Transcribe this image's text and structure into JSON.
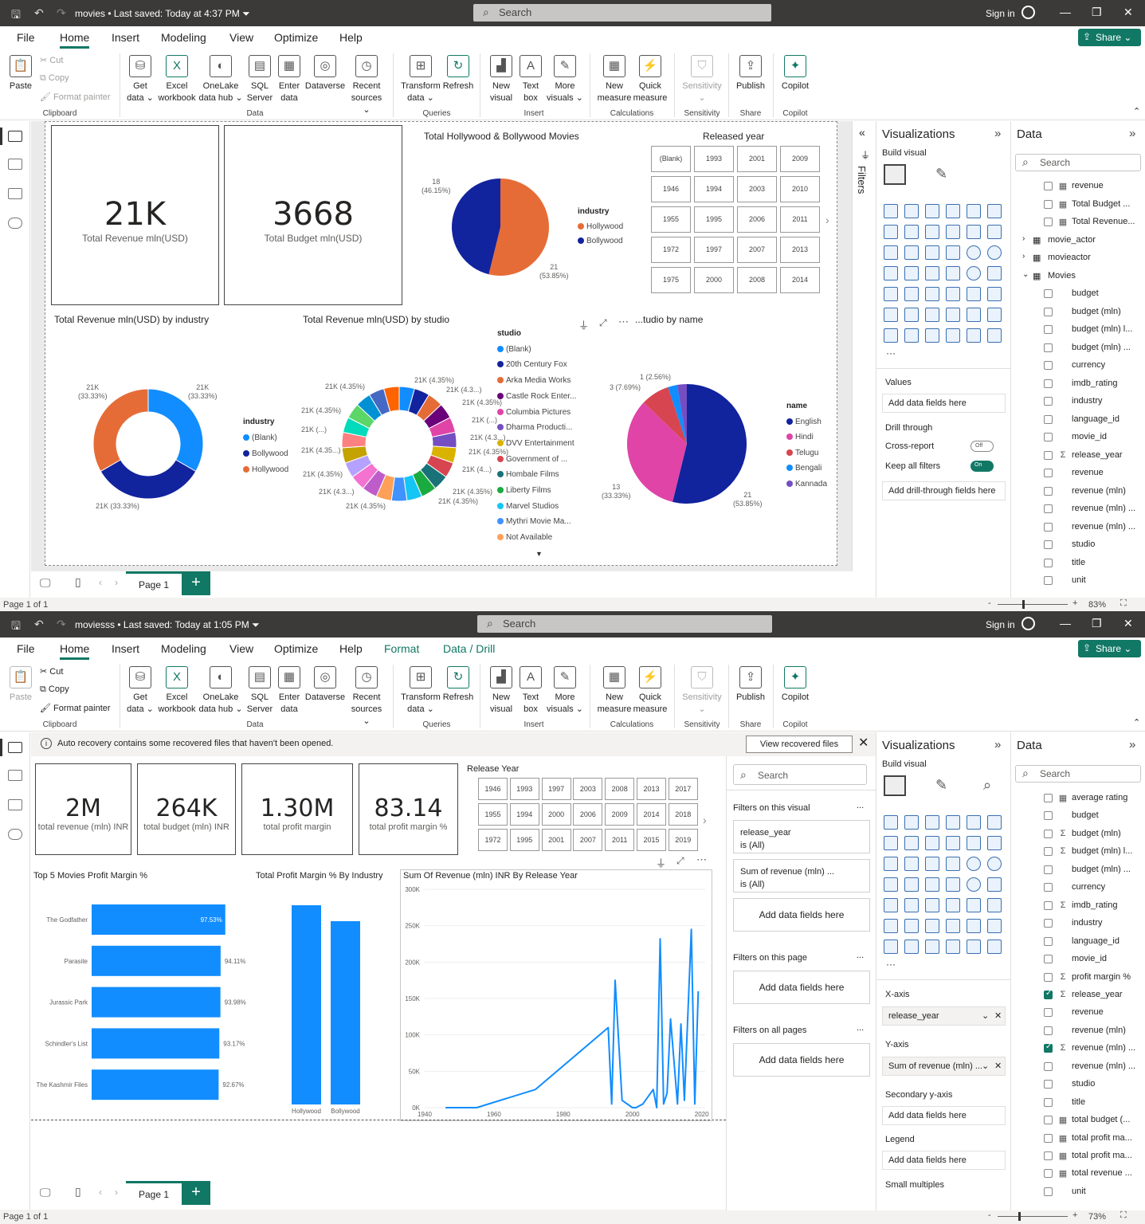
{
  "window1": {
    "title": {
      "filename": "movies",
      "saved": "Last saved: Today at 4:37 PM",
      "search": "Search",
      "signin": "Sign in"
    },
    "menu": [
      "File",
      "Home",
      "Insert",
      "Modeling",
      "View",
      "Optimize",
      "Help"
    ],
    "share": "Share",
    "ribbon": {
      "paste": "Paste",
      "cut": "Cut",
      "copy": "Copy",
      "format_painter": "Format painter",
      "get_data": "Get data ⌄",
      "excel": "Excel workbook",
      "onelake": "OneLake data hub ⌄",
      "sql": "SQL Server",
      "enter_data": "Enter data",
      "dataverse": "Dataverse",
      "recent": "Recent sources ⌄",
      "transform": "Transform data ⌄",
      "refresh": "Refresh",
      "new_visual": "New visual",
      "text_box": "Text box",
      "more_visuals": "More visuals ⌄",
      "new_measure": "New measure",
      "quick_measure": "Quick measure",
      "sensitivity": "Sensitivity ⌄",
      "publish": "Publish",
      "copilot": "Copilot",
      "groups": [
        "Clipboard",
        "Data",
        "Queries",
        "Insert",
        "Calculations",
        "Sensitivity",
        "Share",
        "Copilot"
      ]
    },
    "cards": [
      {
        "value": "21K",
        "label": "Total Revenue mln(USD)"
      },
      {
        "value": "3668",
        "label": "Total Budget mln(USD)"
      }
    ],
    "pie1": {
      "title": "Total Hollywood & Bollywood Movies",
      "legend_title": "industry",
      "legend": [
        "Hollywood",
        "Bollywood"
      ],
      "labels": [
        {
          "v": "18",
          "p": "(46.15%)"
        },
        {
          "v": "21",
          "p": "(53.85%)"
        }
      ]
    },
    "slicer": {
      "title": "Released year",
      "values": [
        "(Blank)",
        "1993",
        "2001",
        "2009",
        "1946",
        "1994",
        "2003",
        "2010",
        "1955",
        "1995",
        "2006",
        "2011",
        "1972",
        "1997",
        "2007",
        "2013",
        "1975",
        "2000",
        "2008",
        "2014"
      ]
    },
    "donut1": {
      "title": "Total Revenue mln(USD) by industry",
      "legend_title": "industry",
      "legend": [
        "(Blank)",
        "Bollywood",
        "Hollywood"
      ],
      "labels": [
        {
          "v": "21K",
          "p": "(33.33%)"
        },
        {
          "v": "21K",
          "p": "(33.33%)"
        },
        {
          "v": "21K (33.33%)",
          "p": ""
        }
      ]
    },
    "donut2": {
      "title": "Total Revenue mln(USD) by studio",
      "legend_title": "studio",
      "legend": [
        "(Blank)",
        "20th Century Fox",
        "Arka Media Works",
        "Castle Rock Enter...",
        "Columbia Pictures",
        "Dharma Producti...",
        "DVV Entertainment",
        "Government of ...",
        "Hombale Films",
        "Liberty Films",
        "Marvel Studios",
        "Mythri Movie Ma...",
        "Not Available"
      ],
      "labels": [
        "21K (4.35%)",
        "21K (4.3...)",
        "21K (4.35%)",
        "21K (...)",
        "21K (4.3...)",
        "21K (4.35%)",
        "21K (4...)",
        "21K (4.35%)",
        "21K (4.35%)",
        "21K (4.35%)",
        "21K (4.3...)",
        "21K (4.35%)",
        "21K (4.35...)",
        "21K (...)",
        "21K (4.35%)",
        "21K (4.35%)"
      ]
    },
    "pie2": {
      "title": "...tudio by name",
      "legend_title": "name",
      "legend": [
        "English",
        "Hindi",
        "Telugu",
        "Bengali",
        "Kannada"
      ],
      "labels": [
        {
          "v": "1 (2.56%)"
        },
        {
          "v": "3 (7.69%)"
        },
        {
          "v": "13",
          "p": "(33.33%)"
        },
        {
          "v": "21",
          "p": "(53.85%)"
        }
      ]
    },
    "page_tab": "Page 1",
    "status": {
      "page": "Page 1 of 1",
      "zoom": "83%"
    },
    "filters_label": "Filters",
    "viz_pane": {
      "title": "Visualizations",
      "build": "Build visual",
      "values": "Values",
      "add_fields": "Add data fields here",
      "drill": "Drill through",
      "cross": "Cross-report",
      "keep": "Keep all filters",
      "off": "Off",
      "on": "On",
      "add_drill": "Add drill-through fields here"
    },
    "data_pane": {
      "title": "Data",
      "search": "Search",
      "rows": [
        {
          "name": "revenue",
          "type": "calc"
        },
        {
          "name": "Total Budget ...",
          "type": "calc"
        },
        {
          "name": "Total Revenue...",
          "type": "calc"
        },
        {
          "name": "movie_actor",
          "type": "table"
        },
        {
          "name": "movieactor",
          "type": "table"
        },
        {
          "name": "Movies",
          "type": "table-open"
        },
        {
          "name": "budget",
          "type": ""
        },
        {
          "name": "budget (mln)",
          "type": ""
        },
        {
          "name": "budget (mln) l...",
          "type": ""
        },
        {
          "name": "budget (mln) ...",
          "type": ""
        },
        {
          "name": "currency",
          "type": ""
        },
        {
          "name": "imdb_rating",
          "type": ""
        },
        {
          "name": "industry",
          "type": ""
        },
        {
          "name": "language_id",
          "type": ""
        },
        {
          "name": "movie_id",
          "type": ""
        },
        {
          "name": "release_year",
          "type": "sum"
        },
        {
          "name": "revenue",
          "type": ""
        },
        {
          "name": "revenue (mln)",
          "type": ""
        },
        {
          "name": "revenue (mln) ...",
          "type": ""
        },
        {
          "name": "revenue (mln) ...",
          "type": ""
        },
        {
          "name": "studio",
          "type": ""
        },
        {
          "name": "title",
          "type": ""
        },
        {
          "name": "unit",
          "type": ""
        }
      ]
    }
  },
  "window2": {
    "title": {
      "filename": "moviesss",
      "saved": "Last saved: Today at 1:05 PM",
      "search": "Search",
      "signin": "Sign in"
    },
    "menu": [
      "File",
      "Home",
      "Insert",
      "Modeling",
      "View",
      "Optimize",
      "Help",
      "Format",
      "Data / Drill"
    ],
    "share": "Share",
    "recovery": {
      "message": "Auto recovery contains some recovered files that haven't been opened.",
      "button": "View recovered files"
    },
    "cards": [
      {
        "value": "2M",
        "label": "total revenue (mln) INR"
      },
      {
        "value": "264K",
        "label": "total budget (mln) INR"
      },
      {
        "value": "1.30M",
        "label": "total profit margin"
      },
      {
        "value": "83.14",
        "label": "total profit margin %"
      }
    ],
    "slicer": {
      "title": "Release Year",
      "values": [
        "1946",
        "1993",
        "1997",
        "2003",
        "2008",
        "2013",
        "2017",
        "1955",
        "1994",
        "2000",
        "2006",
        "2009",
        "2014",
        "2018",
        "1972",
        "1995",
        "2001",
        "2007",
        "2011",
        "2015",
        "2019"
      ]
    },
    "filters": {
      "search": "Search",
      "on_visual": "Filters on this visual",
      "f1": {
        "name": "release_year",
        "state": "is (All)"
      },
      "f2": {
        "name": "Sum of revenue (mln) ...",
        "state": "is (All)"
      },
      "add": "Add data fields here",
      "on_page": "Filters on this page",
      "on_all": "Filters on all pages",
      "more": "..."
    },
    "viz_pane": {
      "title": "Visualizations",
      "build": "Build visual",
      "xaxis": "X-axis",
      "xval": "release_year",
      "yaxis": "Y-axis",
      "yval": "Sum of revenue (mln) ...",
      "secondary": "Secondary y-axis",
      "legend": "Legend",
      "small": "Small multiples",
      "add": "Add data fields here"
    },
    "data_pane": {
      "title": "Data",
      "search": "Search",
      "rows": [
        {
          "name": "average rating",
          "type": "calc",
          "checked": false
        },
        {
          "name": "budget",
          "type": "",
          "checked": false
        },
        {
          "name": "budget (mln)",
          "type": "sum",
          "checked": false
        },
        {
          "name": "budget (mln) l...",
          "type": "sum",
          "checked": false
        },
        {
          "name": "budget (mln) ...",
          "type": "",
          "checked": false
        },
        {
          "name": "currency",
          "type": "",
          "checked": false
        },
        {
          "name": "imdb_rating",
          "type": "sum",
          "checked": false
        },
        {
          "name": "industry",
          "type": "",
          "checked": false
        },
        {
          "name": "language_id",
          "type": "",
          "checked": false
        },
        {
          "name": "movie_id",
          "type": "",
          "checked": false
        },
        {
          "name": "profit margin %",
          "type": "sum",
          "checked": false
        },
        {
          "name": "release_year",
          "type": "sum",
          "checked": true
        },
        {
          "name": "revenue",
          "type": "",
          "checked": false
        },
        {
          "name": "revenue (mln)",
          "type": "",
          "checked": false
        },
        {
          "name": "revenue (mln) ...",
          "type": "sum",
          "checked": true
        },
        {
          "name": "revenue (mln) ...",
          "type": "",
          "checked": false
        },
        {
          "name": "studio",
          "type": "",
          "checked": false
        },
        {
          "name": "title",
          "type": "",
          "checked": false
        },
        {
          "name": "total budget (...",
          "type": "calc",
          "checked": false
        },
        {
          "name": "total profit ma...",
          "type": "calc",
          "checked": false
        },
        {
          "name": "total profit ma...",
          "type": "calc",
          "checked": false
        },
        {
          "name": "total revenue ...",
          "type": "calc",
          "checked": false
        },
        {
          "name": "unit",
          "type": "",
          "checked": false
        }
      ]
    },
    "page_tab": "Page 1",
    "status": {
      "page": "Page 1 of 1",
      "zoom": "73%"
    }
  },
  "chart_data": [
    {
      "type": "pie",
      "title": "Total Hollywood & Bollywood Movies",
      "categories": [
        "Hollywood",
        "Bollywood"
      ],
      "values": [
        21,
        18
      ],
      "colors": [
        "#e66c37",
        "#12239e"
      ]
    },
    {
      "type": "pie",
      "title": "Total Revenue mln(USD) by industry",
      "donut": true,
      "categories": [
        "(Blank)",
        "Bollywood",
        "Hollywood"
      ],
      "values": [
        21,
        21,
        21
      ],
      "colors": [
        "#118dff",
        "#12239e",
        "#e66c37"
      ]
    },
    {
      "type": "pie",
      "title": "Total Revenue mln(USD) by studio",
      "donut": true,
      "categories": [
        "(Blank)",
        "20th Century Fox",
        "Arka Media Works",
        "Castle Rock Enter...",
        "Columbia Pictures",
        "Dharma Producti...",
        "DVV Entertainment",
        "Government of ...",
        "Hombale Films",
        "Liberty Films",
        "Marvel Studios",
        "Mythri Movie Ma...",
        "Not Available"
      ],
      "values": [
        1,
        1,
        1,
        1,
        1,
        1,
        1,
        1,
        1,
        1,
        1,
        1,
        1,
        1,
        1,
        1,
        1,
        1,
        1,
        1,
        1,
        1,
        1
      ],
      "colors": [
        "#118dff",
        "#12239e",
        "#e66c37",
        "#6b007b",
        "#e044a7",
        "#744ec2",
        "#d9b300",
        "#d64550",
        "#197278",
        "#1aab40",
        "#15c6f4",
        "#4092ff",
        "#ffa058",
        "#be5dc9",
        "#f472d0",
        "#b5a1ff",
        "#c4a200",
        "#ff8080",
        "#00dbbc",
        "#5bd667",
        "#0091d5",
        "#4668c5",
        "#ff6300"
      ]
    },
    {
      "type": "pie",
      "title": "...tudio by name",
      "categories": [
        "English",
        "Hindi",
        "Telugu",
        "Bengali",
        "Kannada"
      ],
      "values": [
        21,
        13,
        3,
        1,
        1
      ],
      "colors": [
        "#12239e",
        "#e044a7",
        "#d64550",
        "#118dff",
        "#744ec2"
      ]
    },
    {
      "type": "bar",
      "orientation": "horizontal",
      "title": "Top 5 Movies Profit Margin %",
      "categories": [
        "The Godfather",
        "Parasite",
        "Jurassic Park",
        "Schindler's List",
        "The Kashmir Files"
      ],
      "values": [
        97.53,
        94.11,
        93.98,
        93.17,
        92.67
      ],
      "value_labels": [
        "97.53%",
        "94.11%",
        "93.98%",
        "93.17%",
        "92.67%"
      ],
      "color": "#118dff"
    },
    {
      "type": "bar",
      "title": "Total Profit Margin % By Industry",
      "categories": [
        "Hollywood",
        "Bollywood"
      ],
      "values": [
        100,
        92
      ],
      "color": "#118dff"
    },
    {
      "type": "line",
      "title": "Sum Of Revenue (mln) INR By Release Year",
      "x": [
        1946,
        1955,
        1972,
        1993,
        1994,
        1995,
        1997,
        2000,
        2001,
        2003,
        2006,
        2007,
        2008,
        2009,
        2010,
        2011,
        2013,
        2014,
        2015,
        2017,
        2018,
        2019
      ],
      "y": [
        0,
        0,
        25000,
        110000,
        5000,
        175000,
        10000,
        0,
        0,
        5000,
        25000,
        0,
        232000,
        5000,
        20000,
        122000,
        5000,
        115000,
        10000,
        245000,
        5000,
        160000
      ],
      "xticks": [
        "1940",
        "1960",
        "1980",
        "2000",
        "2020"
      ],
      "yticks": [
        "0K",
        "50K",
        "100K",
        "150K",
        "200K",
        "250K",
        "300K"
      ],
      "xlim": [
        1940,
        2021
      ],
      "ylim": [
        0,
        300000
      ],
      "color": "#118dff"
    }
  ]
}
